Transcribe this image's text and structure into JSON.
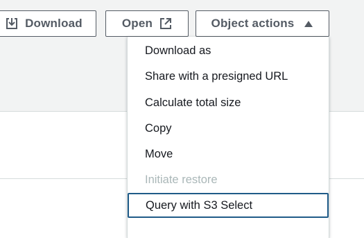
{
  "toolbar": {
    "download_label": "Download",
    "open_label": "Open",
    "object_actions_label": "Object actions"
  },
  "menu": {
    "items": [
      {
        "label": "Download as",
        "enabled": true
      },
      {
        "label": "Share with a presigned URL",
        "enabled": true
      },
      {
        "label": "Calculate total size",
        "enabled": true
      },
      {
        "label": "Copy",
        "enabled": true
      },
      {
        "label": "Move",
        "enabled": true
      },
      {
        "label": "Initiate restore",
        "enabled": false
      },
      {
        "label": "Query with S3 Select",
        "enabled": true,
        "focused": true
      }
    ]
  },
  "icons": {
    "download": "download-icon",
    "open": "external-link-icon",
    "object_actions": "caret-up-icon"
  },
  "colors": {
    "button_text": "#545b64",
    "focus_ring": "#1f5b88",
    "disabled_text": "#aab7b8",
    "panel_background": "#f2f3f3"
  }
}
